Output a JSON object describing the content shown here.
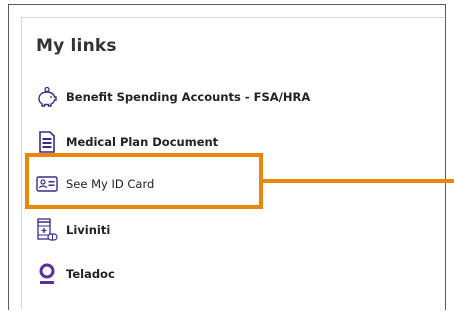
{
  "panel": {
    "title": "My links",
    "links": [
      {
        "label": "Benefit Spending Accounts - FSA/HRA",
        "icon": "piggy-bank-icon"
      },
      {
        "label": "Medical Plan Document",
        "icon": "document-icon"
      },
      {
        "label": "See My ID Card",
        "icon": "id-card-icon"
      },
      {
        "label": "Liviniti",
        "icon": "pharmacy-icon"
      },
      {
        "label": "Teladoc",
        "icon": "location-pin-icon"
      }
    ]
  },
  "colors": {
    "highlight": "#e8870d",
    "icon": "#3a2a8c",
    "teladoc": "#5a2ea6"
  }
}
